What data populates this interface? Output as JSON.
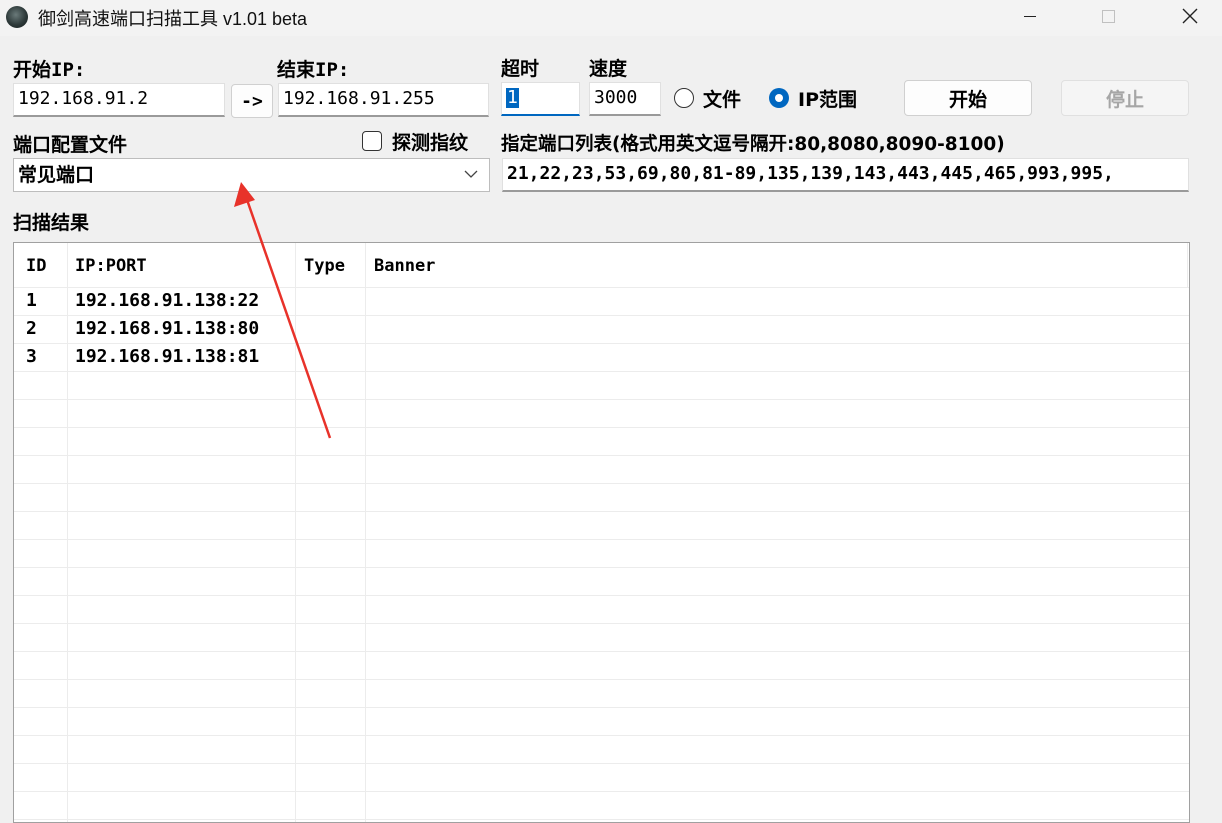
{
  "window": {
    "title": "御剑高速端口扫描工具 v1.01 beta",
    "controls": [
      "minimize-icon",
      "maximize-icon",
      "close-icon"
    ]
  },
  "form": {
    "start_ip_label": "开始IP:",
    "start_ip_value": "192.168.91.2",
    "arrow_button_label": "->",
    "end_ip_label": "结束IP:",
    "end_ip_value": "192.168.91.255",
    "timeout_label": "超时",
    "timeout_value": "1",
    "speed_label": "速度",
    "speed_value": "3000",
    "radio_file_label": "文件",
    "radio_file_selected": false,
    "radio_iprange_label": "IP范围",
    "radio_iprange_selected": true,
    "start_button_label": "开始",
    "stop_button_label": "停止",
    "port_config_label": "端口配置文件",
    "probe_fingerprint_label": "探测指纹",
    "probe_fingerprint_checked": false,
    "port_list_label": "指定端口列表(格式用英文逗号隔开:80,8080,8090-8100)",
    "port_config_value": "常见端口",
    "port_list_value": "21,22,23,53,69,80,81-89,135,139,143,443,445,465,993,995,"
  },
  "results": {
    "section_label": "扫描结果",
    "columns": [
      "ID",
      "IP:PORT",
      "Type",
      "Banner"
    ],
    "rows": [
      {
        "id": "1",
        "ip_port": "192.168.91.138:22",
        "type": "",
        "banner": ""
      },
      {
        "id": "2",
        "ip_port": "192.168.91.138:80",
        "type": "",
        "banner": ""
      },
      {
        "id": "3",
        "ip_port": "192.168.91.138:81",
        "type": "",
        "banner": ""
      }
    ]
  },
  "colors": {
    "accent": "#0067c0",
    "annotation_arrow": "#e8322a",
    "disabled_text": "#a6a6a6"
  }
}
